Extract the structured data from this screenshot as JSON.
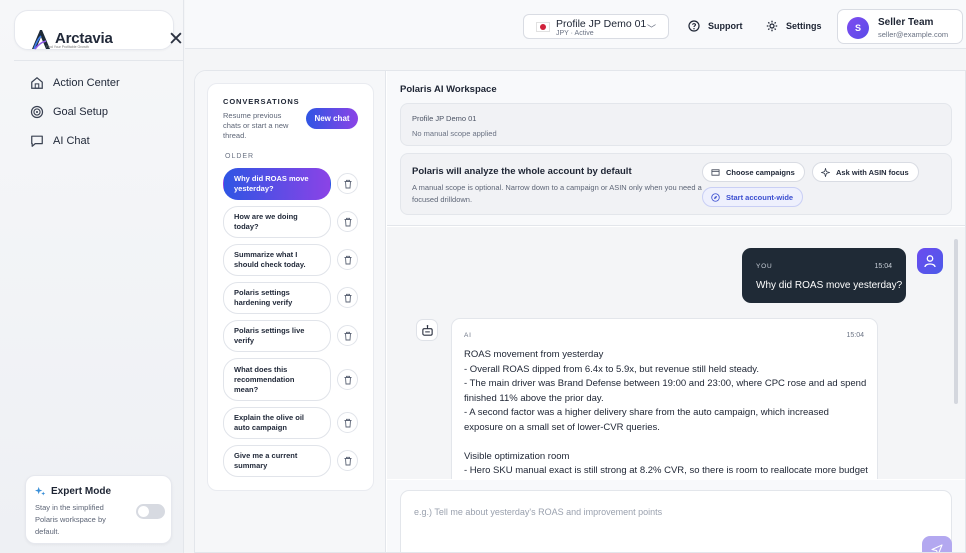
{
  "brand": {
    "name": "Arctavia",
    "tagline": "Find Your Profitable Growth"
  },
  "sidebar": {
    "items": [
      {
        "label": "Action Center",
        "icon": "home-icon"
      },
      {
        "label": "Goal Setup",
        "icon": "target-icon"
      },
      {
        "label": "AI Chat",
        "icon": "chat-icon"
      }
    ],
    "expert_mode": {
      "title": "Expert Mode",
      "description": "Stay in the simplified Polaris workspace by default.",
      "enabled": false
    }
  },
  "topbar": {
    "profile": {
      "name": "Profile JP Demo 01",
      "sub": "JPY · Active",
      "flag": "jp-flag-icon"
    },
    "support_label": "Support",
    "settings_label": "Settings",
    "user": {
      "initial": "S",
      "name": "Seller Team",
      "email": "seller@example.com"
    }
  },
  "conversations": {
    "title": "CONVERSATIONS",
    "description": "Resume previous chats or start a new thread.",
    "new_chat_label": "New chat",
    "older_label": "OLDER",
    "threads": [
      {
        "title": "Why did ROAS move yesterday?",
        "active": true
      },
      {
        "title": "How are we doing today?",
        "active": false
      },
      {
        "title": "Summarize what I should check today.",
        "active": false
      },
      {
        "title": "Polaris settings hardening verify",
        "active": false
      },
      {
        "title": "Polaris settings live verify",
        "active": false
      },
      {
        "title": "What does this recommendation mean?",
        "active": false
      },
      {
        "title": "Explain the olive oil auto campaign",
        "active": false
      },
      {
        "title": "Give me a current summary",
        "active": false
      }
    ]
  },
  "workspace": {
    "title": "Polaris AI Workspace",
    "scope": {
      "profile": "Profile JP Demo 01",
      "note": "No manual scope applied"
    },
    "analyze": {
      "title": "Polaris will analyze the whole account by default",
      "description": "A manual scope is optional. Narrow down to a campaign or ASIN only when you need a focused drilldown.",
      "choose_campaigns": "Choose campaigns",
      "ask_asin": "Ask with ASIN focus",
      "start_account": "Start account-wide"
    }
  },
  "messages": [
    {
      "role": "YOU",
      "time": "15:04",
      "text": "Why did ROAS move yesterday?"
    },
    {
      "role": "AI",
      "time": "15:04",
      "lines": [
        "ROAS movement from yesterday",
        "- Overall ROAS dipped from 6.4x to 5.9x, but revenue still held steady.",
        "- The main driver was Brand Defense between 19:00 and 23:00, where CPC rose and ad spend",
        "finished 11% above the prior day.",
        "- A second factor was a higher delivery share from the auto campaign, which increased",
        "exposure on a small set of lower-CVR queries.",
        "",
        "Visible optimization room",
        "- Hero SKU manual exact is still strong at 8.2% CVR, so there is room to reallocate more budget"
      ]
    }
  ],
  "composer": {
    "placeholder": "e.g.) Tell me about yesterday's ROAS and improvement points",
    "value": ""
  },
  "colors": {
    "accent_start": "#2f55e4",
    "accent_end": "#8b43e6",
    "user_bubble": "#1f2a36",
    "send_button": "#b3a8f0"
  }
}
